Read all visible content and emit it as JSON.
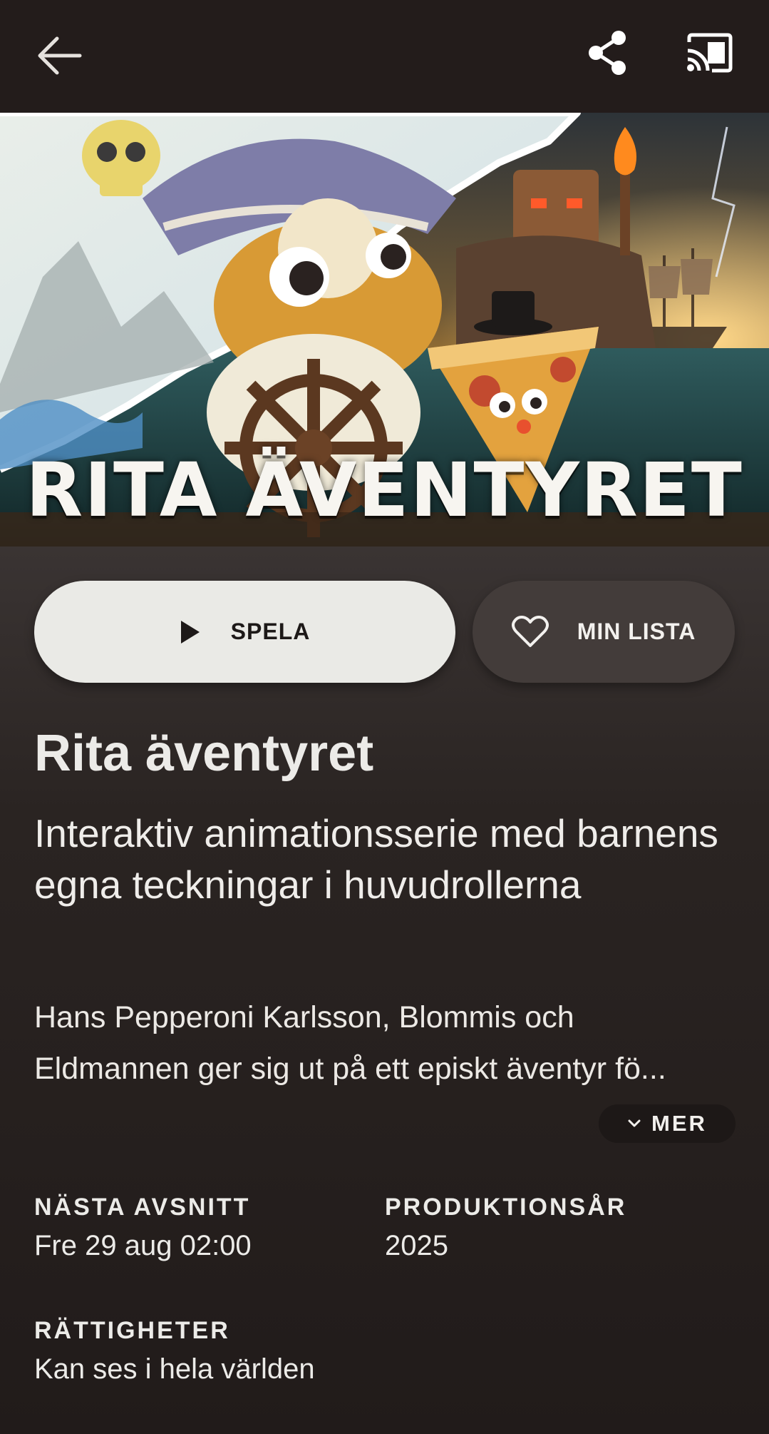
{
  "header": {
    "back_icon": "arrow-left-icon",
    "share_icon": "share-icon",
    "cast_icon": "cast-icon"
  },
  "hero": {
    "logo_text": "RITA ÄVENTYRET"
  },
  "actions": {
    "play_label": "SPELA",
    "play_icon": "play-icon",
    "list_label": "MIN LISTA",
    "list_icon": "heart-icon"
  },
  "show": {
    "title": "Rita äventyret",
    "tagline": "Interaktiv animationsserie med barnens egna teckningar i huvudrollerna",
    "description_line1": "Hans Pepperoni Karlsson, Blommis och",
    "description_line2": "Eldmannen ger sig ut på ett episkt äventyr fö...",
    "more_label": "MER"
  },
  "meta": {
    "next_episode_label": "NÄSTA AVSNITT",
    "next_episode_value": "Fre 29 aug 02:00",
    "production_year_label": "PRODUKTIONSÅR",
    "production_year_value": "2025",
    "rights_label": "RÄTTIGHETER",
    "rights_value": "Kan ses i hela världen"
  },
  "colors": {
    "background": "#231e1d",
    "play_button": "#eaeae6",
    "list_button": "#433c3a",
    "text": "#ecebe8"
  }
}
